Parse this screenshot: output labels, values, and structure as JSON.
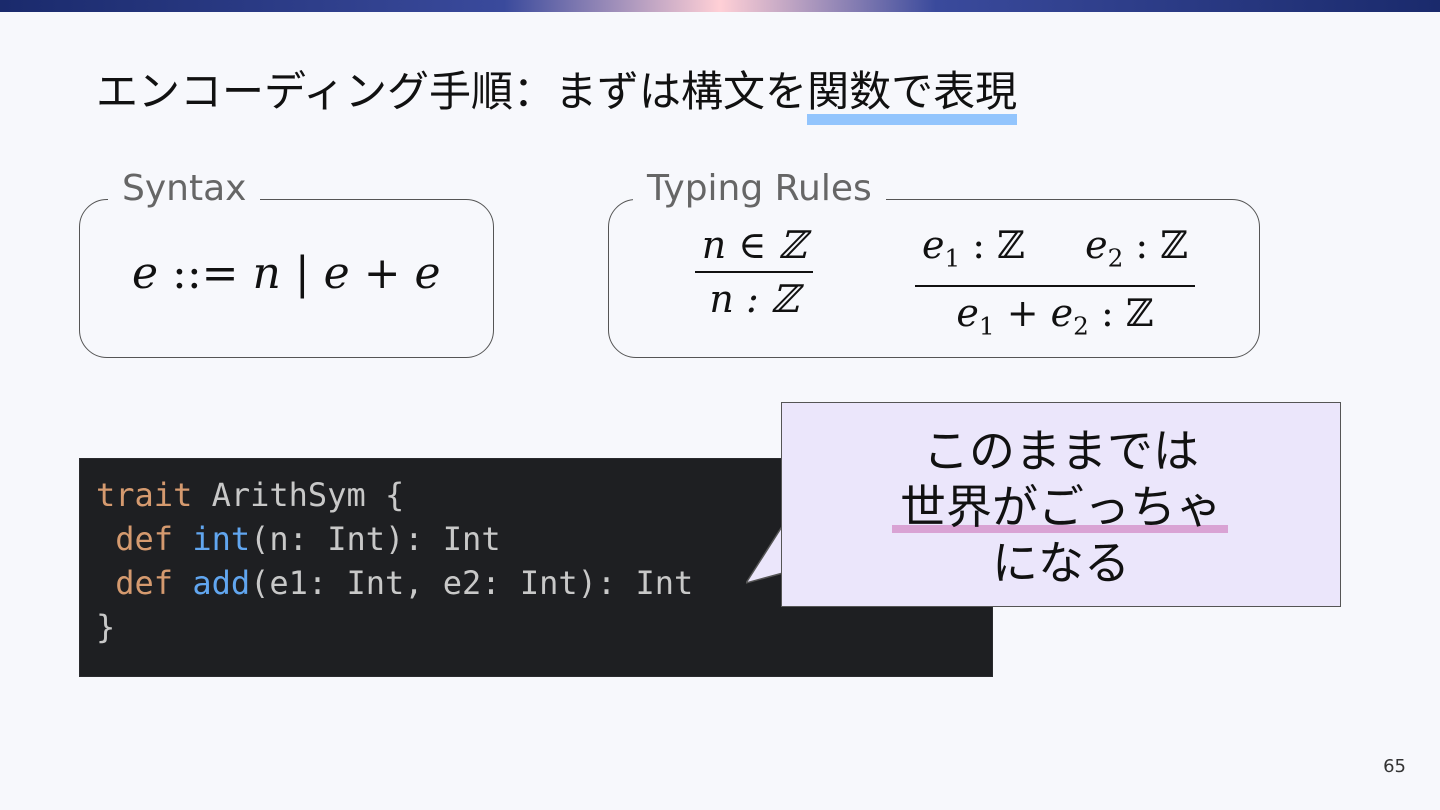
{
  "title": {
    "prefix": "エンコーディング手順：まずは構文を",
    "highlight": "関数で表現"
  },
  "syntax": {
    "legend": "Syntax",
    "lhs": "e",
    "defsym": " ::= ",
    "rhs": "n | e + e"
  },
  "typing": {
    "legend": "Typing Rules",
    "rule1": {
      "premise": "n ∈ ℤ",
      "conclusion": "n : ℤ"
    },
    "rule2": {
      "premise_a": "e",
      "premise_a_sub": "1",
      "premise_a_type": " : ℤ",
      "premise_b": "e",
      "premise_b_sub": "2",
      "premise_b_type": " : ℤ",
      "conclusion_a": "e",
      "conclusion_a_sub": "1",
      "conclusion_plus": " + ",
      "conclusion_b": "e",
      "conclusion_b_sub": "2",
      "conclusion_type": " : ℤ"
    }
  },
  "code": {
    "line1": {
      "kw": "trait",
      "rest": " ArithSym {"
    },
    "line2": {
      "indent": " ",
      "kw": "def",
      "sp": " ",
      "fn": "int",
      "rest": "(n: Int): Int"
    },
    "line3": {
      "indent": " ",
      "kw": "def",
      "sp": " ",
      "fn": "add",
      "rest": "(e1: Int, e2: Int): Int"
    },
    "line4": {
      "rest": "}"
    }
  },
  "callout": {
    "line1": "このままでは",
    "line2": "世界がごっちゃ",
    "line3": "になる"
  },
  "page_number": "65",
  "colors": {
    "title_highlight": "#93c5fd",
    "callout_bg": "#ebe6fb",
    "callout_underline": "#d9a3d4",
    "code_bg": "#1e1f22",
    "code_keyword": "#d59a6f",
    "code_function": "#61a6f0"
  }
}
